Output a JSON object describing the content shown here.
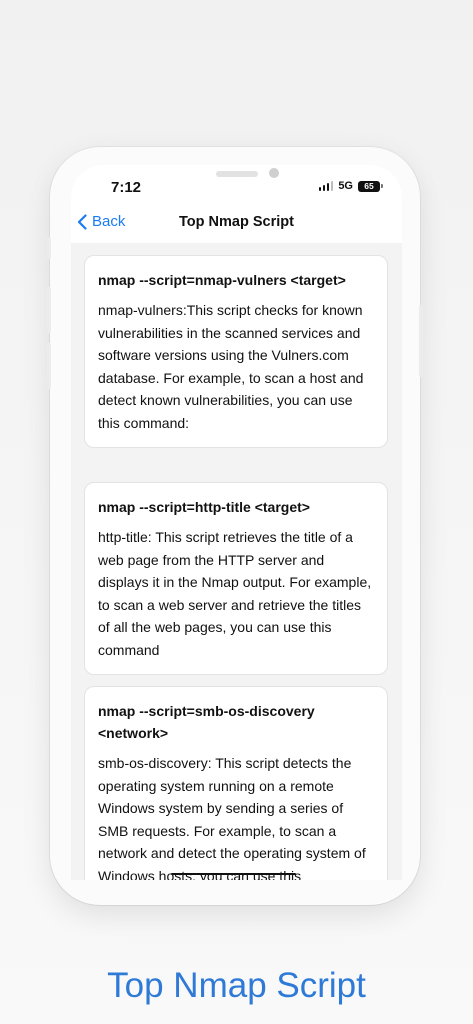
{
  "status_bar": {
    "time": "7:12",
    "network": "5G",
    "battery": "65"
  },
  "nav": {
    "back_label": "Back",
    "title": "Top Nmap Script"
  },
  "cards": [
    {
      "command": "nmap --script=nmap-vulners <target>",
      "description": "nmap-vulners:This script checks for known vulnerabilities in the scanned services and software versions using the Vulners.com database. For example, to scan a host and detect known vulnerabilities, you can use this command:"
    },
    {
      "command": "nmap --script=http-title <target>",
      "description": "http-title: This script retrieves the title of a web page from the HTTP server and displays it in the Nmap output. For example, to scan a web server and retrieve the titles of all the web pages, you can use this command"
    },
    {
      "command": "nmap --script=smb-os-discovery <network>",
      "description": "smb-os-discovery: This script detects the operating system running on a remote Windows system by sending a series of SMB requests. For example, to scan a network and detect the operating system of Windows hosts, you can use this"
    }
  ],
  "caption": "Top Nmap Script",
  "colors": {
    "accent": "#1a7cf2",
    "caption": "#2e7ad6",
    "background": "#f3f3f3"
  },
  "icons": [
    "chevron-left-icon",
    "signal-icon",
    "battery-icon"
  ]
}
